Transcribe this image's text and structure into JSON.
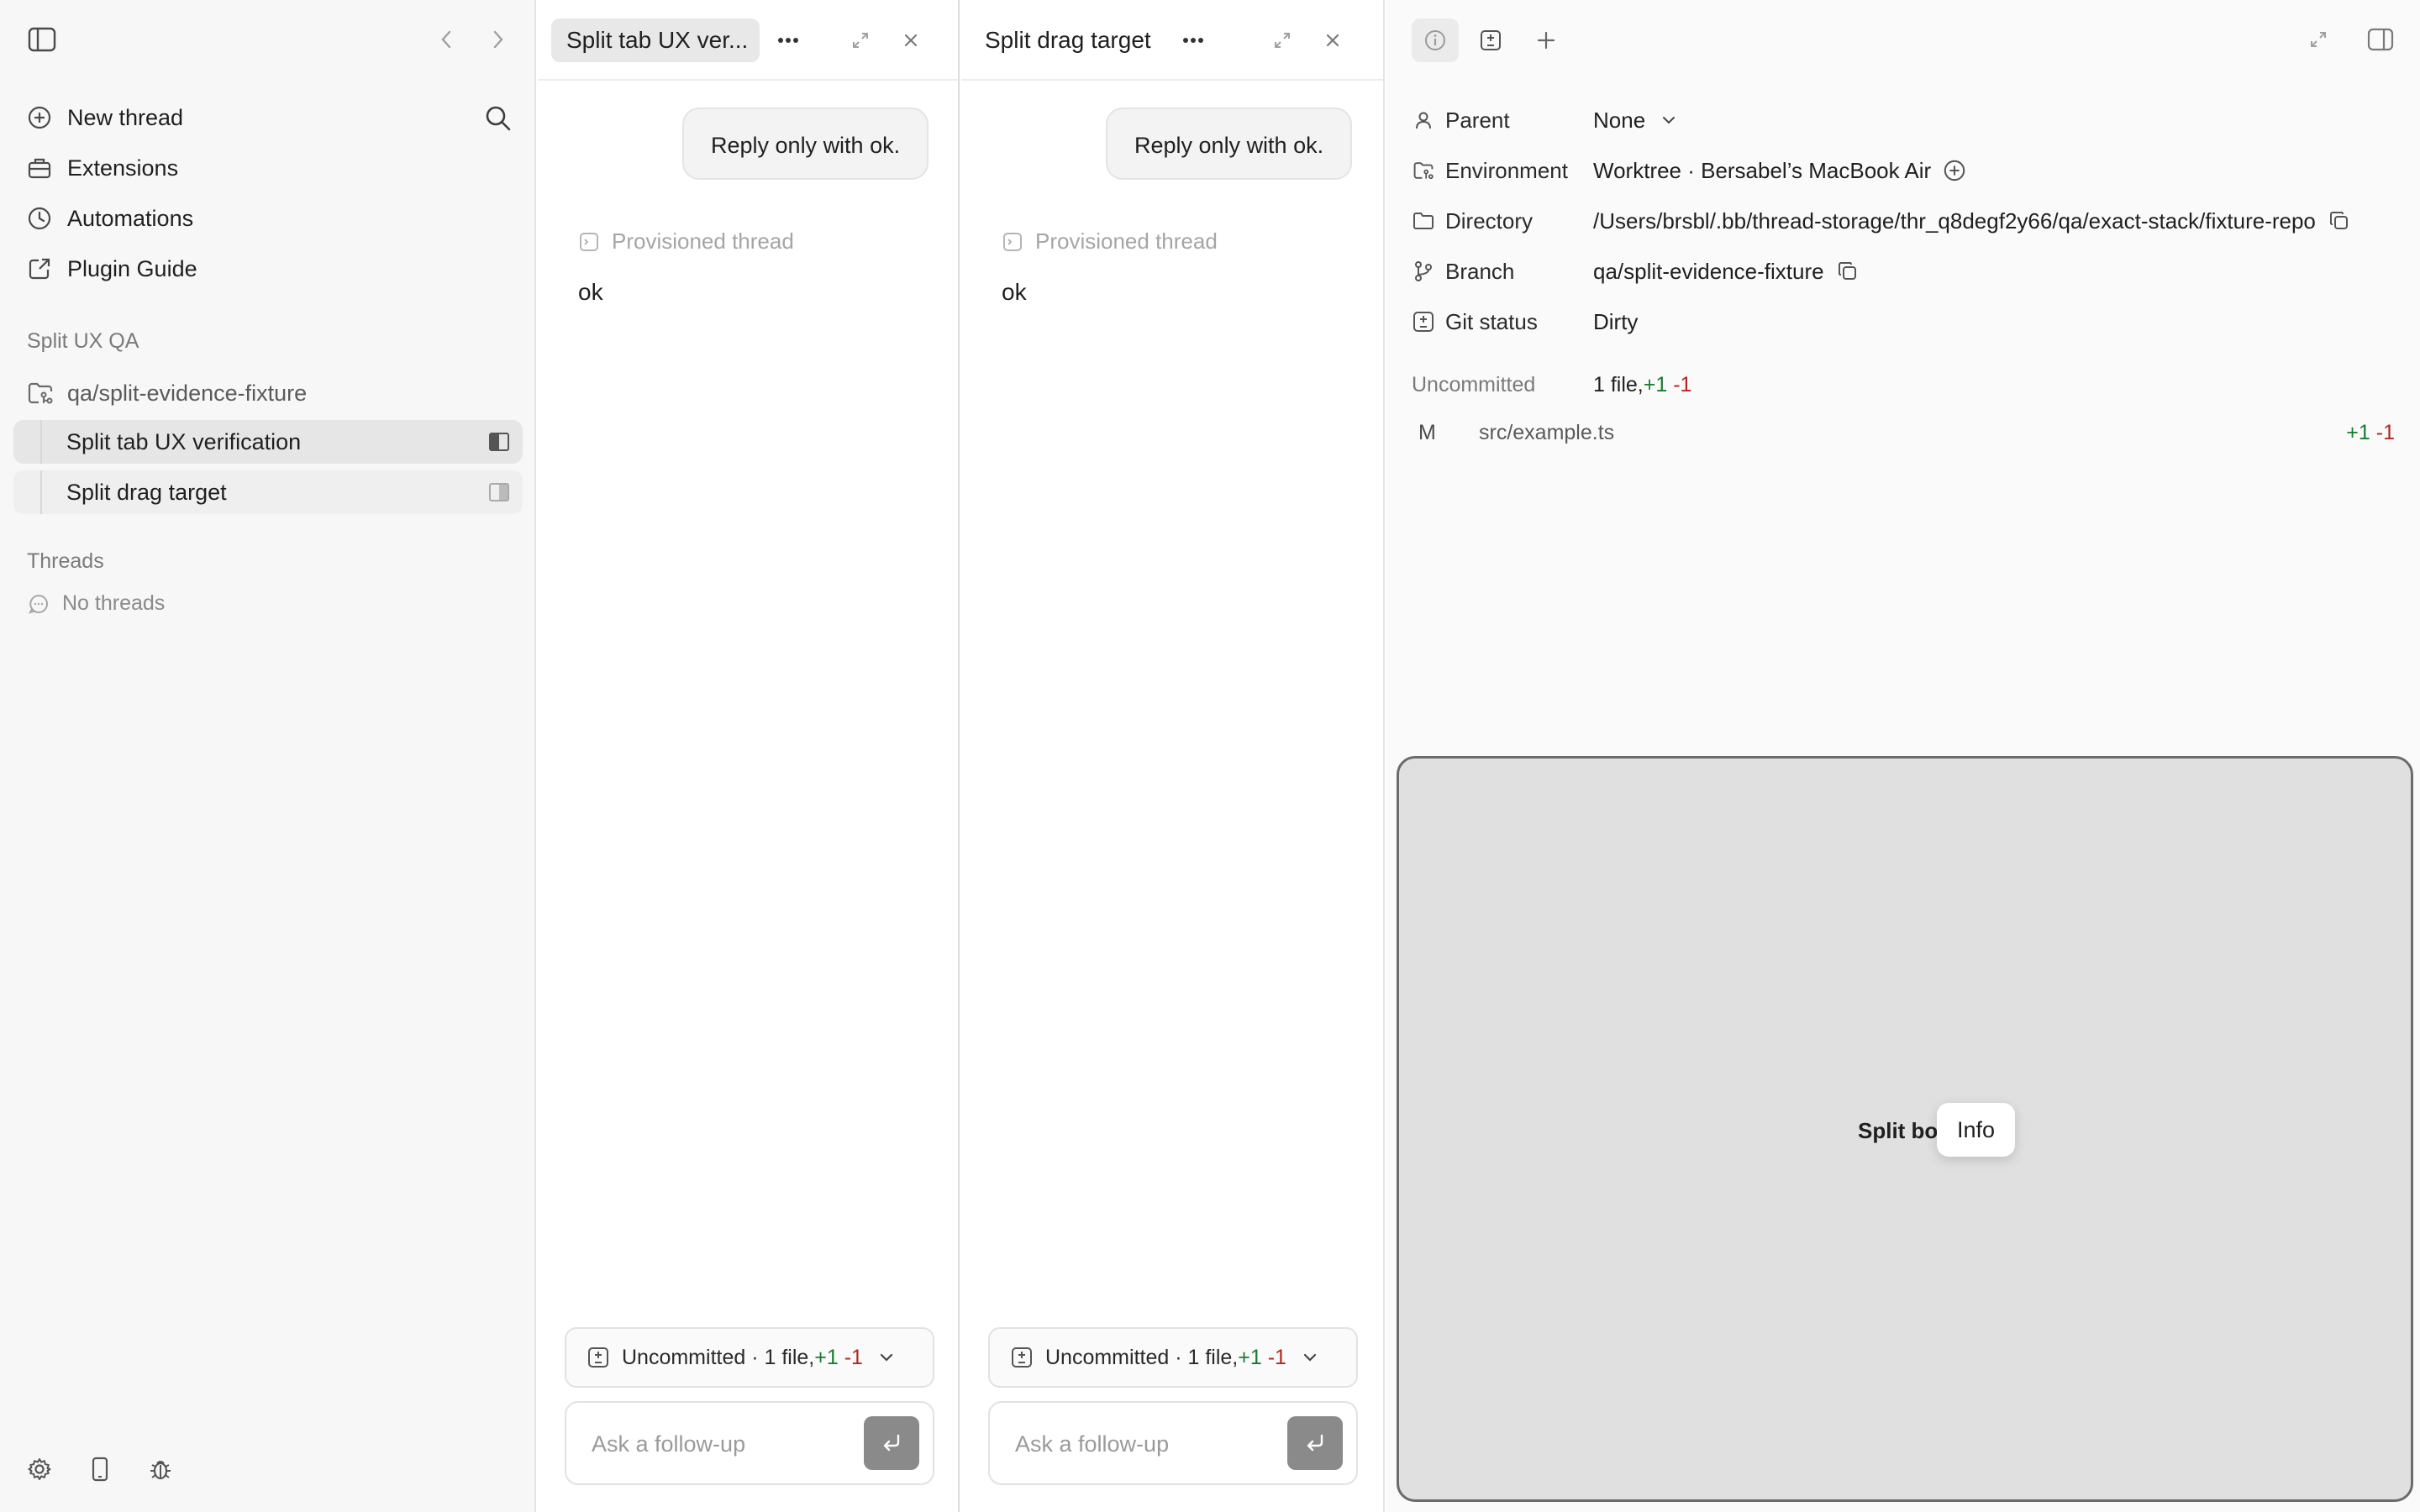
{
  "sidebar": {
    "menu": [
      {
        "label": "New thread",
        "icon": "plus-circle-icon"
      },
      {
        "label": "Extensions",
        "icon": "toolbox-icon"
      },
      {
        "label": "Automations",
        "icon": "clock-icon"
      },
      {
        "label": "Plugin Guide",
        "icon": "external-square-icon"
      }
    ],
    "project_section": "Split UX QA",
    "repo": "qa/split-evidence-fixture",
    "threads": [
      {
        "label": "Split tab UX verification",
        "state": "active"
      },
      {
        "label": "Split drag target",
        "state": "secondary"
      }
    ],
    "threads_section": "Threads",
    "no_threads": "No threads"
  },
  "panes": [
    {
      "tab_title": "Split tab UX ver...",
      "user_message": "Reply only with ok.",
      "provisioned_label": "Provisioned thread",
      "reply": "ok",
      "uncommitted": {
        "prefix": "Uncommitted · 1 file, ",
        "added": "+1",
        "removed": "-1"
      },
      "composer_placeholder": "Ask a follow-up"
    },
    {
      "tab_title": "Split drag target",
      "user_message": "Reply only with ok.",
      "provisioned_label": "Provisioned thread",
      "reply": "ok",
      "uncommitted": {
        "prefix": "Uncommitted · 1 file, ",
        "added": "+1",
        "removed": "-1"
      },
      "composer_placeholder": "Ask a follow-up"
    }
  ],
  "info": {
    "parent": {
      "label": "Parent",
      "value": "None"
    },
    "environment": {
      "label": "Environment",
      "value": "Worktree · Bersabel’s MacBook Air"
    },
    "directory": {
      "label": "Directory",
      "value": "/Users/brsbl/.bb/thread-storage/thr_q8degf2y66/qa/exact-stack/fixture-repo"
    },
    "branch": {
      "label": "Branch",
      "value": "qa/split-evidence-fixture"
    },
    "git_status": {
      "label": "Git status",
      "value": "Dirty"
    },
    "uncommitted": {
      "label": "Uncommitted",
      "prefix": "1 file, ",
      "added": "+1",
      "removed": "-1"
    },
    "file": {
      "status": "M",
      "path": "src/example.ts",
      "added": "+1",
      "removed": "-1"
    }
  },
  "drop_zone": {
    "label": "Split bot",
    "tooltip": "Info"
  },
  "colors": {
    "added": "#1a7a2e",
    "removed": "#b3261e",
    "drop_zone_bg": "#e0e0e0"
  }
}
